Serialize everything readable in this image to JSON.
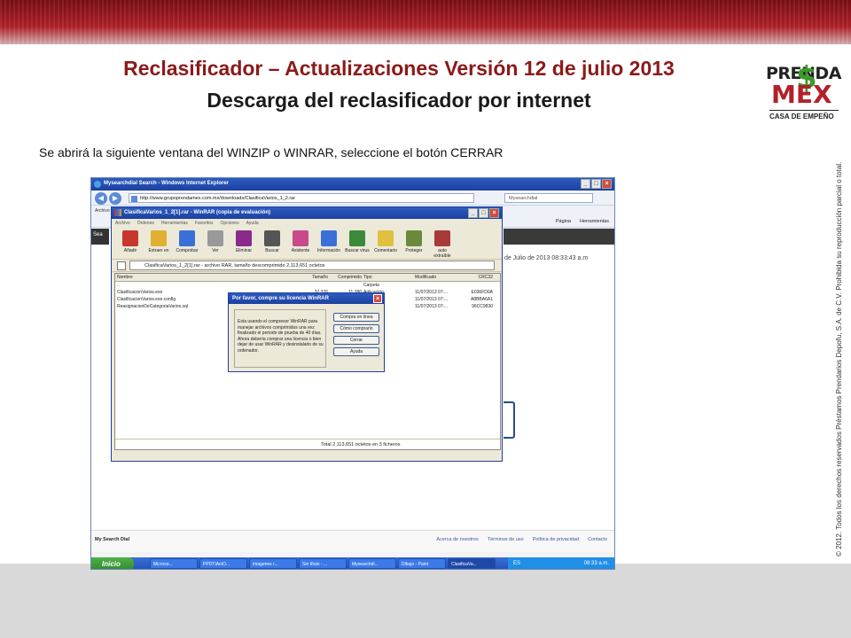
{
  "slide": {
    "title": "Reclasificador – Actualizaciones Versión 12 de julio 2013",
    "subtitle": "Descarga del reclasificador por internet",
    "instruction": "Se abrirá la siguiente ventana del WINZIP o WINRAR, seleccione el botón CERRAR",
    "logo": {
      "line1": "PRENDA",
      "line2": "MEX",
      "line3": "CASA DE EMPEÑO"
    },
    "copyright": "© 2012. Todos los derechos reservados Préstamos Prendarios Depofu, S.A. de C.V. Prohibida su reproducción parcial o total."
  },
  "ie": {
    "title": "Mysearchdial Search - Windows Internet Explorer",
    "url": "http://www.grupoprendamex.com.mx/downloads/ClasificaVarios_1_2.rar",
    "search_placeholder": "Mysearchdial",
    "menu_label": "Archivo",
    "cmd_items": [
      "Página",
      "Herramientas"
    ],
    "page_left_text": "Sea",
    "page_date": "de Julio de 2013 08:33:43 a.m",
    "footer_left": "My Search Dial",
    "footer_links": [
      "Acerca de nosotros",
      "Términos de uso",
      "Política de privacidad",
      "Contacto"
    ]
  },
  "taskbar": {
    "start": "Inicio",
    "tasks": [
      "Microso...",
      "PPDTIActO...",
      "imagenes r...",
      "Sin título - ...",
      "Mysearchdi...",
      "Dibujo - Paint",
      "ClasificaVa..."
    ],
    "lang": "ES",
    "clock": "08:33 a.m."
  },
  "winrar": {
    "title": "ClasificaVarios_1_2[1].rar - WinRAR (copia de evaluación)",
    "menu": [
      "Archivo",
      "Órdenes",
      "Herramientas",
      "Favoritos",
      "Opciones",
      "Ayuda"
    ],
    "tools": [
      {
        "label": "Añadir",
        "color": "#c8372d"
      },
      {
        "label": "Extraer en",
        "color": "#e0b030"
      },
      {
        "label": "Comprobar",
        "color": "#3a6fd8"
      },
      {
        "label": "Ver",
        "color": "#999999"
      },
      {
        "label": "Eliminar",
        "color": "#8a2a8a"
      },
      {
        "label": "Buscar",
        "color": "#555555"
      },
      {
        "label": "Asistente",
        "color": "#c84a8a"
      },
      {
        "label": "Información",
        "color": "#3a6fd8"
      },
      {
        "label": "Buscar virus",
        "color": "#3a8a3a"
      },
      {
        "label": "Comentario",
        "color": "#e0c040"
      },
      {
        "label": "Proteger",
        "color": "#6a8a3a"
      },
      {
        "label": "auto extraíble",
        "color": "#a83a3a"
      }
    ],
    "path": "ClasificaVarios_1_2[1].rar - archivo RAR, tamaño descomprimido 2,113,651 octetos",
    "columns": {
      "name": "Nombre",
      "size": "Tamaño",
      "comp": "Comprimido",
      "type": "Tipo",
      "mod": "Modificado",
      "crc": "CRC32"
    },
    "rows": [
      {
        "name": "..",
        "size": "",
        "comp": "",
        "type": "Carpeta",
        "mod": "",
        "crc": ""
      },
      {
        "name": "ClasificacionVarios.exe",
        "size": "37,376",
        "comp": "11,380",
        "type": "Aplicación",
        "mod": "11/07/2013 07:...",
        "crc": "E036FD0A"
      },
      {
        "name": "ClasificacionVarios.exe.config",
        "size": "",
        "comp": "",
        "type": "",
        "mod": "11/07/2013 07:...",
        "crc": "A8BBA6A1"
      },
      {
        "name": "ReasignacionDeCategoriaVarios.sql",
        "size": "",
        "comp": "",
        "type": "",
        "mod": "11/07/2013 07:...",
        "crc": "96CC9830"
      }
    ],
    "status": "Total 2,113,651 octetos en 3 ficheros"
  },
  "dialog": {
    "title": "Por favor, compre su licencia WinRAR",
    "text": "Esta usando el compresor WinRAR para manejar archivos comprimidos una vez finalizado el periodo de prueba de 40 días. Ahora debería comprar una licencia o bien dejar de usar WinRAR y desinstalarlo de su ordenador.",
    "buttons": {
      "buy": "Compra en línea",
      "how": "Cómo comprarlo",
      "close": "Cerrar",
      "help": "Ayuda"
    }
  }
}
